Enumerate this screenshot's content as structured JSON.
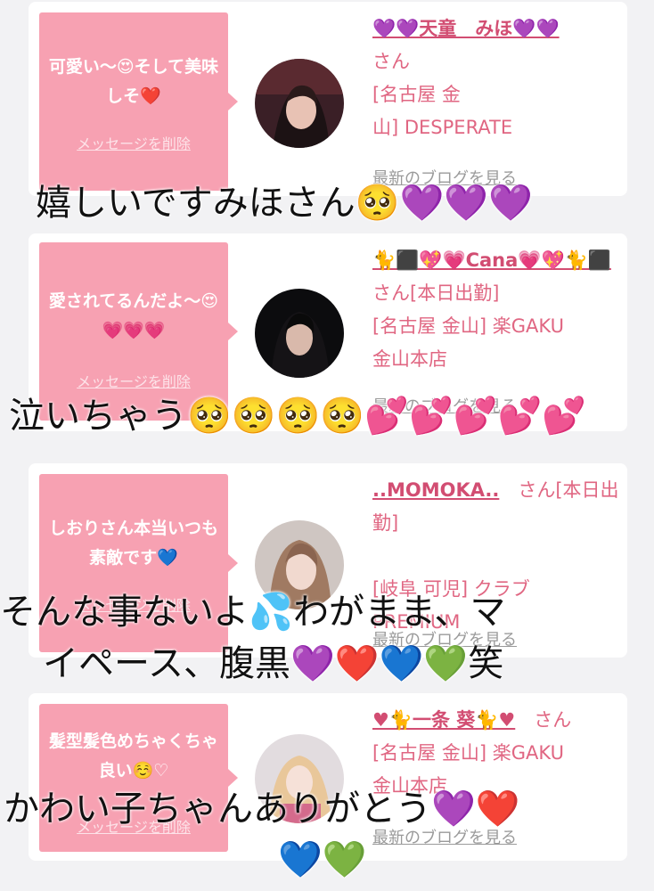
{
  "cards": [
    {
      "message": "可愛い〜😍そして美味しそ❤️",
      "delete_label": "メッセージを削除",
      "name": "💜💜天童　みほ💜💜",
      "san": "さん",
      "shop_line1": "[名古屋 金",
      "shop_line2": "山] DESPERATE",
      "shop_line3": "",
      "blog_link": "最新のブログを見る"
    },
    {
      "message": "愛されてるんだよ〜😍💗💗💗",
      "delete_label": "メッセージを削除",
      "name": "🐈⬛💖💗Cana💗💖🐈⬛",
      "san": "さん[本日出勤]",
      "shop_line1": "[名古屋 金山] 楽GAKU",
      "shop_line2": "金山本店",
      "shop_line3": "",
      "blog_link": "最新のブログを見る"
    },
    {
      "message": "しおりさん本当いつも素敵です💙",
      "delete_label": "メッセージを削除",
      "name": "..MOMOKA..",
      "san": "さん[本日出勤]",
      "shop_line1": "[岐阜 可児] クラブ",
      "shop_line2": "PREMIUM",
      "shop_line3": "",
      "blog_link": "最新のブログを見る"
    },
    {
      "message": "髪型髪色めちゃくちゃ良い☺️♡",
      "delete_label": "メッセージを削除",
      "name": "♥🐈一条 葵🐈♥",
      "san": "さん",
      "shop_line1": "[名古屋 金山] 楽GAKU",
      "shop_line2": "金山本店",
      "shop_line3": "",
      "blog_link": "最新のブログを見る"
    }
  ],
  "captions": {
    "c1": "嬉しいですみほさん🥺💜💜💜",
    "c2": "泣いちゃう🥺🥺🥺🥺💕💕💕💕💕",
    "c3_line1": "そんな事ないよ💦わがまま、マ",
    "c3_line2": "イペース、腹黒💜❤️💙💚笑",
    "c4_line1": "かわい子ちゃんありがとう💜❤️",
    "c4_line2": "💙💚"
  },
  "colors": {
    "bubble": "#f7a1b2",
    "accent": "#e06682",
    "name": "#d24d72",
    "background": "#f2f2f4"
  }
}
